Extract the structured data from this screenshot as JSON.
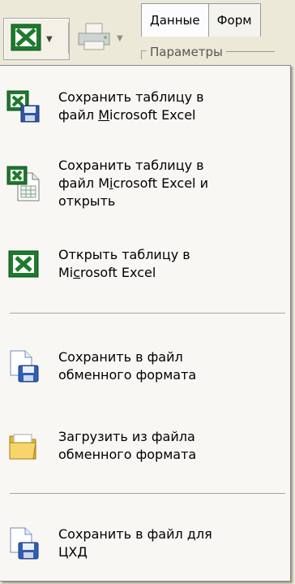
{
  "toolbar": {
    "tabs": [
      "Данные",
      "Форм"
    ],
    "group_label": "Параметры",
    "excel_button_icon": "excel-icon",
    "print_button_icon": "printer-icon"
  },
  "menu": {
    "items": [
      {
        "line1": "Сохранить таблицу в",
        "line2_pre": "файл ",
        "line2_u": "M",
        "line2_post": "icrosoft Excel",
        "icon": "excel-save-icon"
      },
      {
        "line1": "Сохранить таблицу в",
        "line2_pre": "файл M",
        "line2_u": "i",
        "line2_post": "crosoft Excel и",
        "line3": "открыть",
        "icon": "excel-open-doc-icon"
      },
      {
        "line1": "Открыть таблицу в",
        "line2_pre": "Mi",
        "line2_u": "c",
        "line2_post": "rosoft Excel",
        "icon": "excel-icon"
      },
      {
        "line1": "Сохранить в файл",
        "line2": "обменного формата",
        "icon": "save-file-icon"
      },
      {
        "line1": "Загрузить из файла",
        "line2": "обменного формата",
        "icon": "open-folder-icon"
      },
      {
        "line1": "Сохранить в файл для",
        "line2": "ЦХД",
        "icon": "save-file-icon"
      }
    ]
  },
  "colors": {
    "excel_green": "#1e7a2e",
    "menu_bg": "#f8f7f4",
    "toolbar_bg": "#ece9d8"
  }
}
